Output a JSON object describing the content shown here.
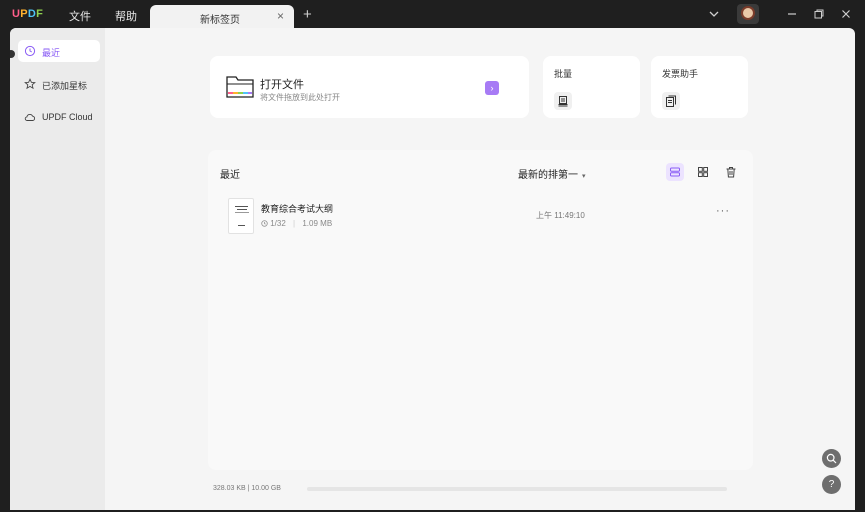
{
  "titlebar": {
    "logo": {
      "u": "U",
      "p": "P",
      "d": "D",
      "f": "F"
    },
    "menu": [
      "文件",
      "帮助"
    ],
    "tab_label": "新标签页",
    "tab_close": "×",
    "new_tab": "+"
  },
  "sidebar": {
    "items": [
      {
        "label": "最近",
        "icon": "clock-icon",
        "active": true
      },
      {
        "label": "已添加星标",
        "icon": "star-icon"
      },
      {
        "label": "UPDF Cloud",
        "icon": "cloud-icon"
      }
    ]
  },
  "open_card": {
    "title": "打开文件",
    "subtitle": "将文件拖放到此处打开",
    "go": "›"
  },
  "batch_card": {
    "title": "批量"
  },
  "invoice_card": {
    "title": "发票助手"
  },
  "recent": {
    "title": "最近",
    "sort_label": "最新的排第一",
    "sort_caret": "▾",
    "files": [
      {
        "name": "教育综合考试大纲",
        "pages": "1/32",
        "size": "1.09 MB",
        "time": "上午 11:49:10",
        "more": "···"
      }
    ]
  },
  "storage": {
    "text": "328.03 KB | 10.00 GB",
    "used_fraction": 0.0
  },
  "fab": {
    "search": "⌕",
    "help": "?"
  },
  "colors": {
    "accent": "#a77bf5",
    "active_text": "#8a5cf5"
  }
}
